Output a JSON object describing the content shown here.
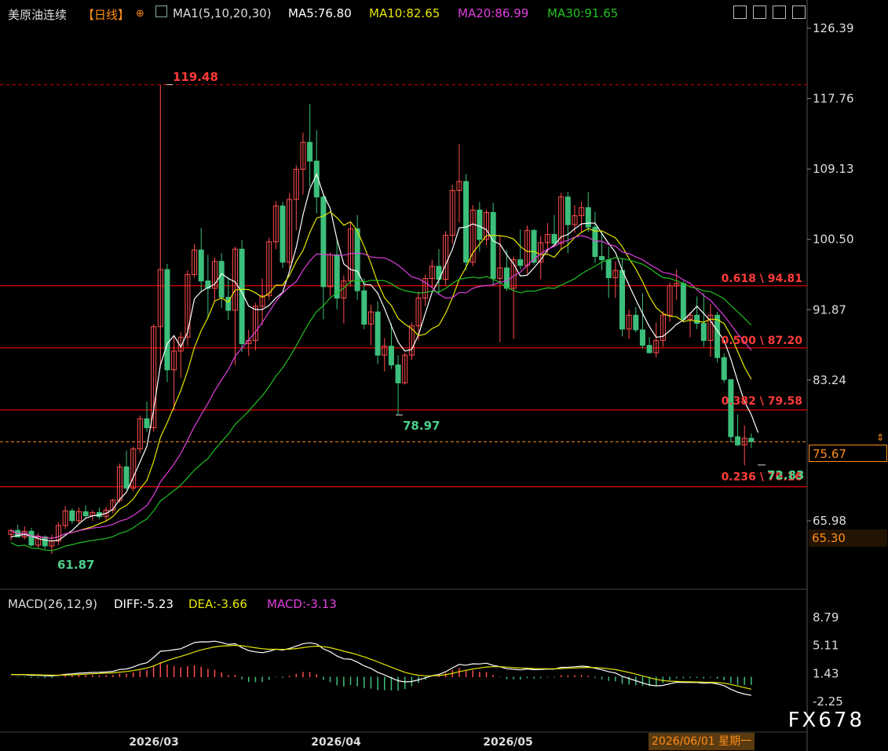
{
  "header": {
    "symbol": "美原油连续",
    "period": "【日线】",
    "indicator": "MA1(5,10,20,30)",
    "ma5": "MA5:76.80",
    "ma10": "MA10:82.65",
    "ma20": "MA20:86.99",
    "ma30": "MA30:91.65"
  },
  "sub_header": {
    "indicator": "MACD(26,12,9)",
    "diff": "DIFF:-5.23",
    "dea": "DEA:-3.66",
    "macd": "MACD:-3.13"
  },
  "price_box": {
    "current": "75.67",
    "low_label": "65.30"
  },
  "footer": {
    "date_label": "2026/06/01 星期一",
    "watermark": "FX678"
  },
  "colors": {
    "background": "#000000",
    "up": "#ff4d4d",
    "down": "#3cbf7a",
    "ma5": "#ffffff",
    "ma10": "#e6e600",
    "ma20": "#e040e0",
    "ma30": "#22c022",
    "fib": "#e00000",
    "label_red": "#ff3b3b",
    "label_green": "#4cd08a"
  },
  "chart_data": [
    {
      "type": "candlestick",
      "title": "美原油连续【日线】",
      "y_ticks": [
        "126.39",
        "117.76",
        "109.13",
        "100.50",
        "91.87",
        "83.24",
        "65.98"
      ],
      "ylim": [
        60,
        127
      ],
      "x_ticks": [
        "2026/03",
        "2026/04",
        "2026/05"
      ],
      "grid": false,
      "annotations": {
        "high": "119.48",
        "low": "61.87",
        "swing_low": "78.97",
        "recent_low": "72.83",
        "current_price": 75.67
      },
      "fib_levels": [
        {
          "label": "0.618 \\ 94.81",
          "value": 94.81
        },
        {
          "label": "0.500 \\ 87.20",
          "value": 87.2
        },
        {
          "label": "0.382 \\ 79.58",
          "value": 79.58
        },
        {
          "label": "0.236 \\ 70.16",
          "value": 70.16
        }
      ],
      "candles": [
        [
          64.3,
          65.0,
          63.6,
          64.8
        ],
        [
          64.8,
          65.5,
          64.2,
          64.0
        ],
        [
          64.0,
          65.3,
          63.7,
          64.7
        ],
        [
          64.7,
          65.1,
          62.8,
          63.0
        ],
        [
          63.0,
          64.5,
          62.7,
          64.0
        ],
        [
          64.0,
          64.2,
          62.5,
          62.9
        ],
        [
          62.9,
          64.3,
          61.9,
          63.5
        ],
        [
          63.5,
          65.8,
          63.0,
          65.4
        ],
        [
          65.4,
          67.8,
          65.0,
          67.2
        ],
        [
          67.2,
          67.5,
          65.6,
          66.0
        ],
        [
          66.0,
          67.6,
          65.7,
          67.1
        ],
        [
          67.1,
          67.9,
          66.3,
          66.6
        ],
        [
          66.6,
          67.3,
          66.0,
          67.0
        ],
        [
          67.0,
          67.6,
          66.2,
          66.5
        ],
        [
          66.5,
          67.7,
          65.9,
          67.3
        ],
        [
          67.3,
          68.7,
          66.9,
          68.5
        ],
        [
          68.5,
          73.0,
          68.2,
          72.6
        ],
        [
          72.6,
          74.6,
          69.8,
          70.0
        ],
        [
          70.0,
          75.1,
          69.6,
          74.8
        ],
        [
          74.8,
          78.9,
          74.3,
          78.5
        ],
        [
          78.5,
          80.6,
          76.9,
          77.4
        ],
        [
          77.4,
          90.1,
          76.9,
          89.8
        ],
        [
          89.8,
          119.5,
          85.1,
          96.8
        ],
        [
          96.8,
          97.5,
          83.0,
          84.5
        ],
        [
          84.5,
          88.5,
          79.6,
          86.8
        ],
        [
          86.8,
          89.1,
          83.5,
          88.5
        ],
        [
          88.5,
          96.7,
          87.4,
          96.2
        ],
        [
          96.2,
          99.9,
          95.8,
          99.2
        ],
        [
          99.2,
          101.9,
          94.2,
          95.4
        ],
        [
          95.4,
          98.6,
          90.8,
          94.5
        ],
        [
          94.5,
          98.3,
          93.0,
          97.8
        ],
        [
          97.8,
          98.8,
          92.1,
          93.4
        ],
        [
          93.4,
          95.9,
          90.6,
          91.8
        ],
        [
          91.8,
          99.6,
          85.1,
          99.3
        ],
        [
          99.3,
          100.4,
          86.7,
          87.7
        ],
        [
          87.7,
          89.4,
          86.2,
          88.1
        ],
        [
          88.1,
          92.7,
          86.9,
          92.3
        ],
        [
          92.3,
          95.7,
          90.0,
          93.6
        ],
        [
          93.6,
          100.7,
          93.1,
          100.2
        ],
        [
          100.2,
          105.2,
          99.3,
          104.6
        ],
        [
          104.6,
          105.1,
          97.0,
          97.7
        ],
        [
          97.7,
          106.2,
          96.9,
          105.4
        ],
        [
          105.4,
          109.6,
          101.6,
          109.1
        ],
        [
          109.1,
          113.6,
          106.0,
          112.4
        ],
        [
          112.4,
          117.1,
          107.0,
          110.1
        ],
        [
          110.1,
          113.9,
          103.7,
          105.7
        ],
        [
          105.7,
          106.0,
          90.7,
          94.7
        ],
        [
          94.7,
          98.9,
          93.5,
          98.6
        ],
        [
          98.6,
          100.5,
          91.9,
          93.3
        ],
        [
          93.3,
          96.1,
          90.2,
          95.4
        ],
        [
          95.4,
          102.7,
          94.7,
          101.8
        ],
        [
          101.8,
          103.5,
          93.1,
          94.2
        ],
        [
          94.2,
          95.7,
          89.5,
          90.1
        ],
        [
          90.1,
          92.5,
          87.5,
          91.6
        ],
        [
          91.6,
          92.9,
          85.2,
          86.3
        ],
        [
          86.3,
          88.4,
          84.3,
          87.4
        ],
        [
          87.4,
          90.2,
          84.6,
          85.1
        ],
        [
          85.1,
          86.3,
          79.0,
          82.9
        ],
        [
          82.9,
          86.6,
          82.7,
          86.3
        ],
        [
          86.3,
          90.3,
          85.7,
          89.9
        ],
        [
          89.9,
          94.1,
          88.1,
          93.3
        ],
        [
          93.3,
          96.2,
          92.3,
          95.7
        ],
        [
          95.7,
          98.0,
          94.5,
          97.2
        ],
        [
          97.2,
          99.3,
          93.8,
          95.6
        ],
        [
          95.6,
          101.5,
          94.8,
          101.0
        ],
        [
          101.0,
          107.2,
          100.0,
          106.5
        ],
        [
          106.5,
          112.2,
          102.6,
          107.6
        ],
        [
          107.6,
          108.5,
          96.7,
          97.7
        ],
        [
          97.7,
          104.7,
          97.2,
          104.1
        ],
        [
          104.1,
          105.1,
          99.0,
          100.5
        ],
        [
          100.5,
          104.1,
          99.8,
          103.8
        ],
        [
          103.8,
          105.0,
          94.8,
          95.7
        ],
        [
          95.7,
          100.9,
          87.9,
          97.0
        ],
        [
          97.0,
          99.2,
          94.2,
          94.5
        ],
        [
          94.5,
          98.4,
          88.3,
          98.0
        ],
        [
          98.0,
          101.7,
          96.8,
          97.3
        ],
        [
          97.3,
          102.2,
          96.3,
          101.6
        ],
        [
          101.6,
          101.8,
          97.4,
          97.7
        ],
        [
          97.7,
          100.9,
          95.6,
          100.1
        ],
        [
          100.1,
          102.5,
          98.8,
          101.1
        ],
        [
          101.1,
          103.5,
          99.9,
          100.0
        ],
        [
          100.0,
          106.2,
          99.3,
          105.7
        ],
        [
          105.7,
          106.3,
          98.8,
          102.3
        ],
        [
          102.3,
          104.7,
          101.3,
          103.4
        ],
        [
          103.4,
          105.1,
          101.4,
          104.4
        ],
        [
          104.4,
          106.3,
          101.4,
          102.0
        ],
        [
          102.0,
          103.9,
          97.6,
          98.4
        ],
        [
          98.4,
          101.4,
          96.7,
          98.0
        ],
        [
          98.0,
          99.6,
          93.3,
          95.8
        ],
        [
          95.8,
          97.8,
          93.3,
          96.7
        ],
        [
          96.7,
          98.2,
          88.6,
          89.5
        ],
        [
          89.5,
          91.9,
          88.3,
          91.2
        ],
        [
          91.2,
          92.2,
          89.1,
          89.4
        ],
        [
          89.4,
          93.9,
          87.1,
          87.5
        ],
        [
          87.5,
          88.5,
          86.5,
          86.6
        ],
        [
          86.6,
          90.3,
          86.0,
          88.1
        ],
        [
          88.1,
          91.7,
          87.3,
          91.2
        ],
        [
          91.2,
          95.2,
          90.4,
          94.8
        ],
        [
          94.8,
          96.8,
          93.1,
          95.1
        ],
        [
          95.1,
          95.4,
          90.3,
          90.7
        ],
        [
          90.7,
          91.6,
          88.5,
          91.2
        ],
        [
          91.2,
          93.5,
          89.5,
          90.2
        ],
        [
          90.2,
          93.9,
          87.3,
          88.1
        ],
        [
          88.1,
          92.6,
          86.1,
          91.2
        ],
        [
          91.2,
          91.6,
          85.4,
          86.0
        ],
        [
          86.0,
          86.5,
          82.9,
          83.3
        ],
        [
          83.3,
          82.2,
          75.6,
          76.3
        ],
        [
          76.3,
          79.0,
          75.1,
          75.3
        ],
        [
          75.3,
          77.7,
          72.8,
          76.1
        ],
        [
          76.1,
          76.7,
          74.9,
          75.7
        ]
      ],
      "ma": {
        "ma5": [
          64,
          64.2,
          64.3,
          64.1,
          63.8,
          63.6,
          63.5,
          63.6,
          64.2,
          64.8,
          65.6,
          66.3,
          66.6,
          66.7,
          66.9,
          67.4,
          68.6,
          69.5,
          71.3,
          73.2,
          75.1,
          79.6,
          85.1,
          87.7,
          88.7,
          87.3,
          89.1,
          93.2,
          94.1,
          94.6,
          95.0,
          96.3,
          95.7,
          95.3,
          94.0,
          92.3,
          91.9,
          91.9,
          92.4,
          93.3,
          94.0,
          96.6,
          99.5,
          103.5,
          106.7,
          108.5,
          106.0,
          104.3,
          100.5,
          97.5,
          96.8,
          96.6,
          95.0,
          94.9,
          93.9,
          92.0,
          89.9,
          87.9,
          86.8,
          87.0,
          88.8,
          91.4,
          94.0,
          95.5,
          97.4,
          99.3,
          101.9,
          102.0,
          102.4,
          102.1,
          101.7,
          100.3,
          99.9,
          98.6,
          97.5,
          96.0,
          96.1,
          97.0,
          98.0,
          99.2,
          99.8,
          100.8,
          101.1,
          101.8,
          102.4,
          102.5,
          102.5,
          101.2,
          100.0,
          98.9,
          96.7,
          94.9,
          93.1,
          91.4,
          89.8,
          88.5,
          88.6,
          89.3,
          90.1,
          90.6,
          91.4,
          92.3,
          91.4,
          90.5,
          89.3,
          88.1,
          85.8,
          83.1,
          80.6,
          79.0,
          76.8
        ]
      },
      "macd": {
        "y_ticks": [
          "8.79",
          "5.11",
          "1.43",
          "-2.25"
        ],
        "diff": -5.23,
        "dea": -3.66,
        "macd": -3.13
      }
    }
  ]
}
